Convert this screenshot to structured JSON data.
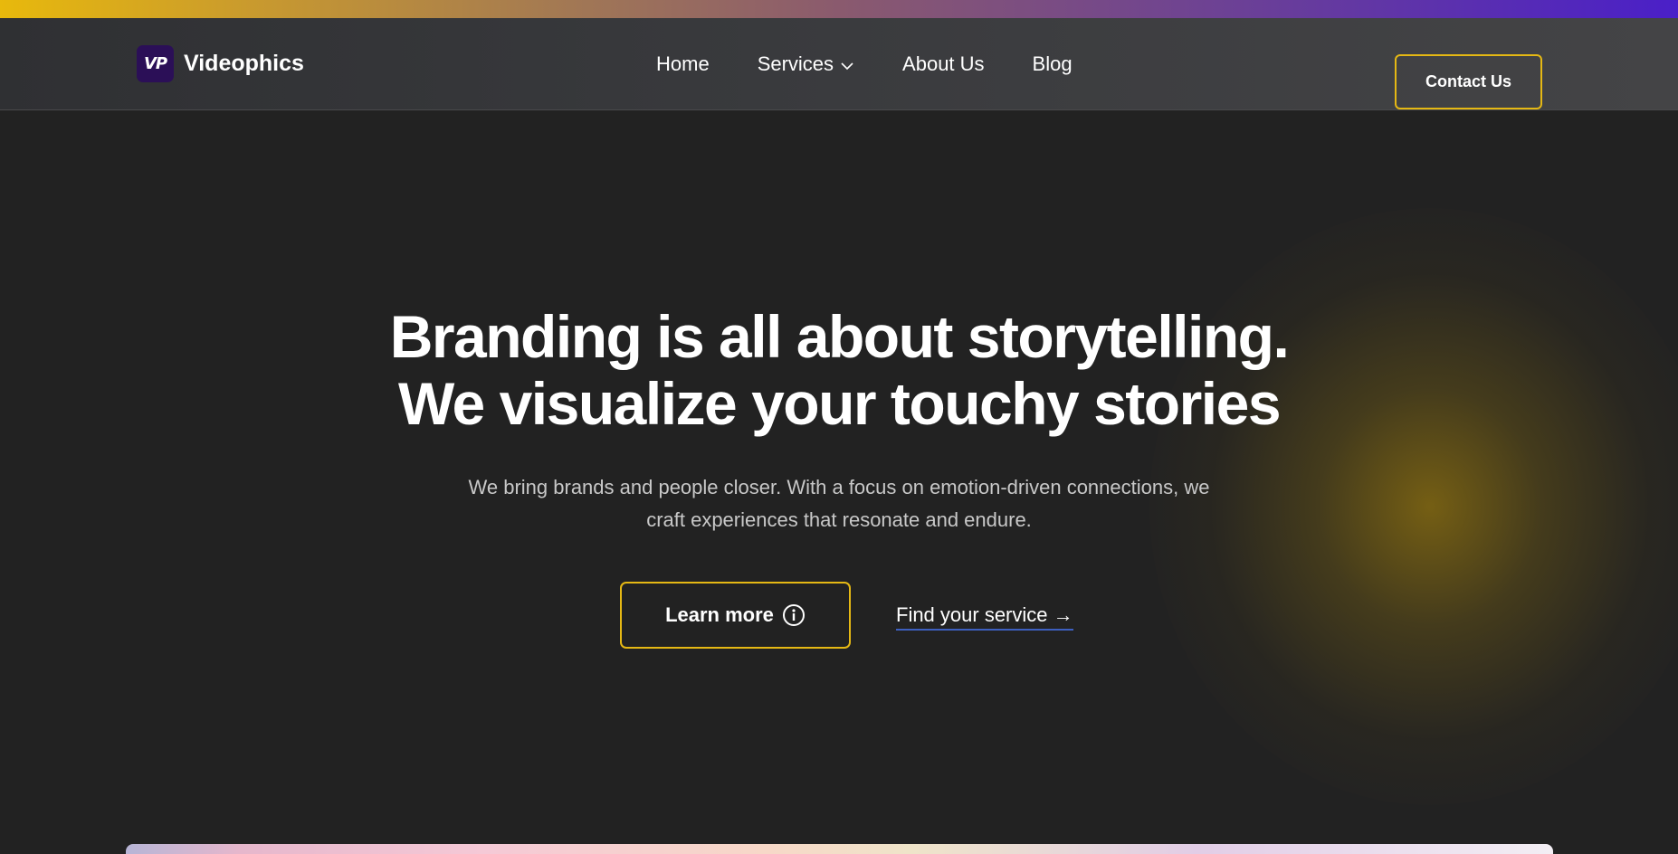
{
  "brand": {
    "logo_text": "VP",
    "name": "Videophics",
    "logo_color": "#2b0f57"
  },
  "nav": {
    "items": [
      {
        "label": "Home"
      },
      {
        "label": "Services",
        "has_dropdown": true,
        "icon": "chevron-down-icon"
      },
      {
        "label": "About Us"
      },
      {
        "label": "Blog"
      }
    ],
    "contact_label": "Contact Us"
  },
  "hero": {
    "title_line1": "Branding is all about storytelling.",
    "title_line2": "We visualize your touchy stories",
    "subtitle_line1": "We bring brands and people closer. With a focus on emotion-driven connections, we",
    "subtitle_line2": "craft experiences that resonate and endure.",
    "learn_more_label": "Learn more",
    "learn_more_icon": "info-icon",
    "find_service_label": "Find your service →"
  },
  "colors": {
    "background": "#222222",
    "accent_border": "#e5b814",
    "link_underline": "#3d5fbf",
    "top_strip_start": "#e8b90c",
    "top_strip_end": "#4a1fc8",
    "subtitle_text": "#c8c8c8"
  }
}
